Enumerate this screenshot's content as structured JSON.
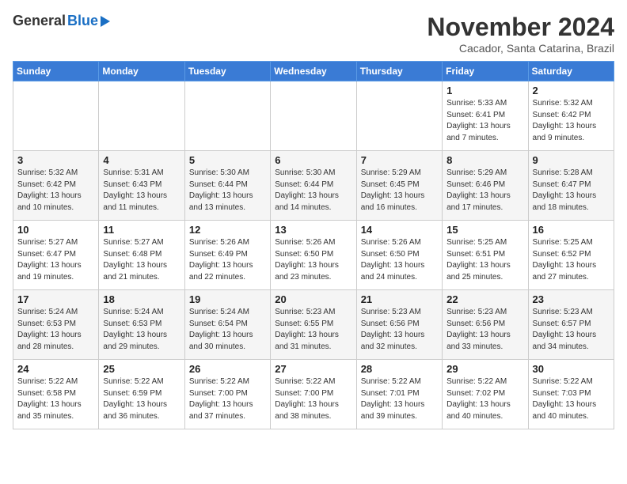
{
  "logo": {
    "general": "General",
    "blue": "Blue"
  },
  "title": "November 2024",
  "location": "Cacador, Santa Catarina, Brazil",
  "weekdays": [
    "Sunday",
    "Monday",
    "Tuesday",
    "Wednesday",
    "Thursday",
    "Friday",
    "Saturday"
  ],
  "weeks": [
    [
      {
        "day": "",
        "info": ""
      },
      {
        "day": "",
        "info": ""
      },
      {
        "day": "",
        "info": ""
      },
      {
        "day": "",
        "info": ""
      },
      {
        "day": "",
        "info": ""
      },
      {
        "day": "1",
        "info": "Sunrise: 5:33 AM\nSunset: 6:41 PM\nDaylight: 13 hours\nand 7 minutes."
      },
      {
        "day": "2",
        "info": "Sunrise: 5:32 AM\nSunset: 6:42 PM\nDaylight: 13 hours\nand 9 minutes."
      }
    ],
    [
      {
        "day": "3",
        "info": "Sunrise: 5:32 AM\nSunset: 6:42 PM\nDaylight: 13 hours\nand 10 minutes."
      },
      {
        "day": "4",
        "info": "Sunrise: 5:31 AM\nSunset: 6:43 PM\nDaylight: 13 hours\nand 11 minutes."
      },
      {
        "day": "5",
        "info": "Sunrise: 5:30 AM\nSunset: 6:44 PM\nDaylight: 13 hours\nand 13 minutes."
      },
      {
        "day": "6",
        "info": "Sunrise: 5:30 AM\nSunset: 6:44 PM\nDaylight: 13 hours\nand 14 minutes."
      },
      {
        "day": "7",
        "info": "Sunrise: 5:29 AM\nSunset: 6:45 PM\nDaylight: 13 hours\nand 16 minutes."
      },
      {
        "day": "8",
        "info": "Sunrise: 5:29 AM\nSunset: 6:46 PM\nDaylight: 13 hours\nand 17 minutes."
      },
      {
        "day": "9",
        "info": "Sunrise: 5:28 AM\nSunset: 6:47 PM\nDaylight: 13 hours\nand 18 minutes."
      }
    ],
    [
      {
        "day": "10",
        "info": "Sunrise: 5:27 AM\nSunset: 6:47 PM\nDaylight: 13 hours\nand 19 minutes."
      },
      {
        "day": "11",
        "info": "Sunrise: 5:27 AM\nSunset: 6:48 PM\nDaylight: 13 hours\nand 21 minutes."
      },
      {
        "day": "12",
        "info": "Sunrise: 5:26 AM\nSunset: 6:49 PM\nDaylight: 13 hours\nand 22 minutes."
      },
      {
        "day": "13",
        "info": "Sunrise: 5:26 AM\nSunset: 6:50 PM\nDaylight: 13 hours\nand 23 minutes."
      },
      {
        "day": "14",
        "info": "Sunrise: 5:26 AM\nSunset: 6:50 PM\nDaylight: 13 hours\nand 24 minutes."
      },
      {
        "day": "15",
        "info": "Sunrise: 5:25 AM\nSunset: 6:51 PM\nDaylight: 13 hours\nand 25 minutes."
      },
      {
        "day": "16",
        "info": "Sunrise: 5:25 AM\nSunset: 6:52 PM\nDaylight: 13 hours\nand 27 minutes."
      }
    ],
    [
      {
        "day": "17",
        "info": "Sunrise: 5:24 AM\nSunset: 6:53 PM\nDaylight: 13 hours\nand 28 minutes."
      },
      {
        "day": "18",
        "info": "Sunrise: 5:24 AM\nSunset: 6:53 PM\nDaylight: 13 hours\nand 29 minutes."
      },
      {
        "day": "19",
        "info": "Sunrise: 5:24 AM\nSunset: 6:54 PM\nDaylight: 13 hours\nand 30 minutes."
      },
      {
        "day": "20",
        "info": "Sunrise: 5:23 AM\nSunset: 6:55 PM\nDaylight: 13 hours\nand 31 minutes."
      },
      {
        "day": "21",
        "info": "Sunrise: 5:23 AM\nSunset: 6:56 PM\nDaylight: 13 hours\nand 32 minutes."
      },
      {
        "day": "22",
        "info": "Sunrise: 5:23 AM\nSunset: 6:56 PM\nDaylight: 13 hours\nand 33 minutes."
      },
      {
        "day": "23",
        "info": "Sunrise: 5:23 AM\nSunset: 6:57 PM\nDaylight: 13 hours\nand 34 minutes."
      }
    ],
    [
      {
        "day": "24",
        "info": "Sunrise: 5:22 AM\nSunset: 6:58 PM\nDaylight: 13 hours\nand 35 minutes."
      },
      {
        "day": "25",
        "info": "Sunrise: 5:22 AM\nSunset: 6:59 PM\nDaylight: 13 hours\nand 36 minutes."
      },
      {
        "day": "26",
        "info": "Sunrise: 5:22 AM\nSunset: 7:00 PM\nDaylight: 13 hours\nand 37 minutes."
      },
      {
        "day": "27",
        "info": "Sunrise: 5:22 AM\nSunset: 7:00 PM\nDaylight: 13 hours\nand 38 minutes."
      },
      {
        "day": "28",
        "info": "Sunrise: 5:22 AM\nSunset: 7:01 PM\nDaylight: 13 hours\nand 39 minutes."
      },
      {
        "day": "29",
        "info": "Sunrise: 5:22 AM\nSunset: 7:02 PM\nDaylight: 13 hours\nand 40 minutes."
      },
      {
        "day": "30",
        "info": "Sunrise: 5:22 AM\nSunset: 7:03 PM\nDaylight: 13 hours\nand 40 minutes."
      }
    ]
  ]
}
